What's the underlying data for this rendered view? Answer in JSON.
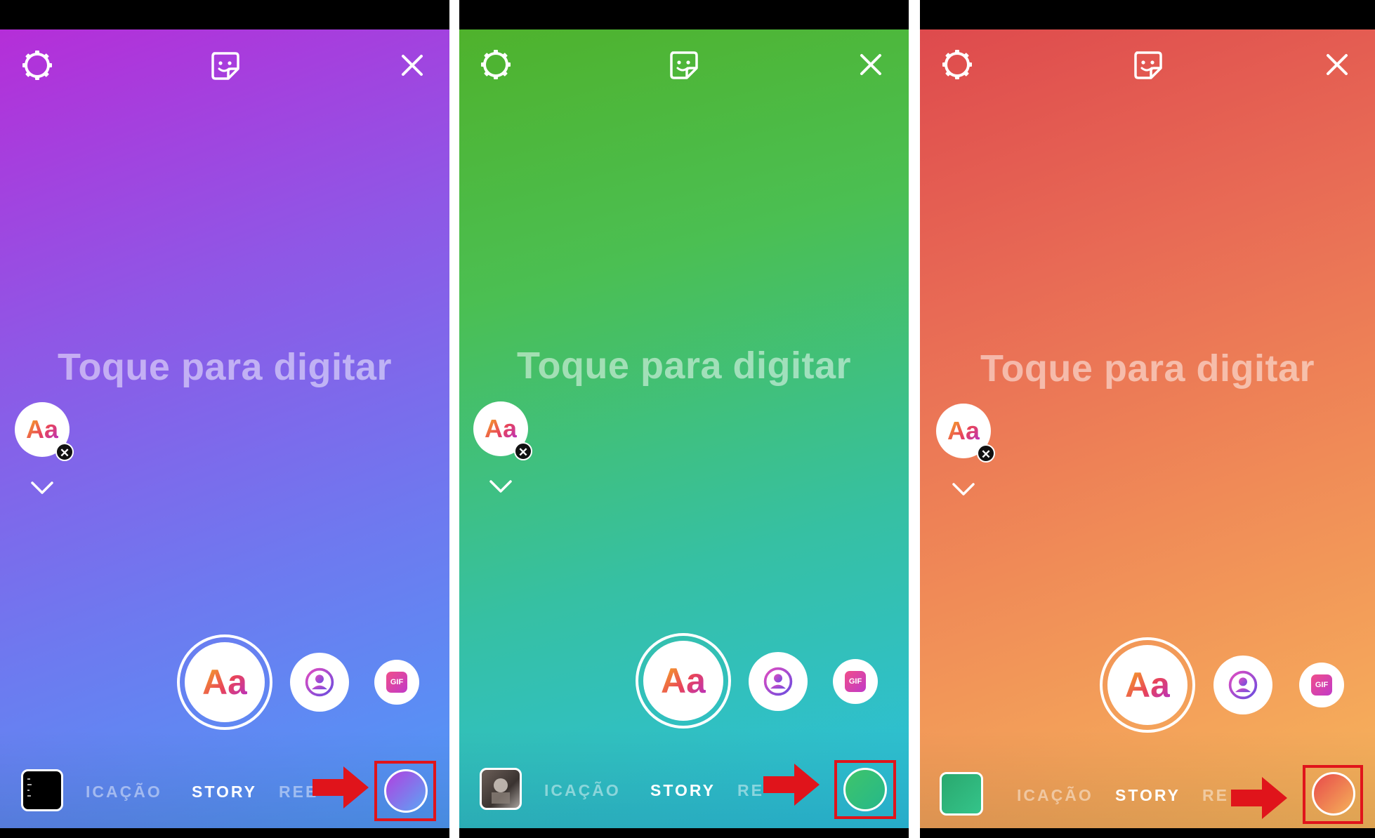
{
  "panels": [
    {
      "hint_text": "Toque para digitar",
      "text_tool_label": "Aa",
      "remove_glyph": "✕",
      "modes": {
        "left": "ICAÇÃO",
        "center": "STORY",
        "right": "REE"
      },
      "gif_label": "GIF",
      "gradient": [
        "#b52ed8",
        "#8e58e6",
        "#5f86f2",
        "#4f9af7"
      ],
      "swatch_color": [
        "#b23fe0",
        "#5aa6f5"
      ]
    },
    {
      "hint_text": "Toque para digitar",
      "text_tool_label": "Aa",
      "remove_glyph": "✕",
      "modes": {
        "left": "ICAÇÃO",
        "center": "STORY",
        "right": "RE"
      },
      "gif_label": "GIF",
      "gradient": [
        "#4fb22c",
        "#4bbf52",
        "#36c0a3",
        "#2bbfe0"
      ],
      "swatch_color": [
        "#3fc46a",
        "#25b88a"
      ]
    },
    {
      "hint_text": "Toque para digitar",
      "text_tool_label": "Aa",
      "remove_glyph": "✕",
      "modes": {
        "left": "ICAÇÃO",
        "center": "STORY",
        "right": "RE"
      },
      "gif_label": "GIF",
      "gradient": [
        "#de4a4d",
        "#e86a55",
        "#f08b57",
        "#f7b65c"
      ],
      "swatch_color": [
        "#e84a4a",
        "#f5b25a"
      ]
    }
  ],
  "icons": {
    "settings": "settings-icon",
    "sticker": "sticker-icon",
    "close": "close-icon",
    "chevron": "chevron-down-icon",
    "mention": "mention-icon",
    "arrow": "red-arrow-annotation"
  },
  "annotation_color": "#e0141b"
}
